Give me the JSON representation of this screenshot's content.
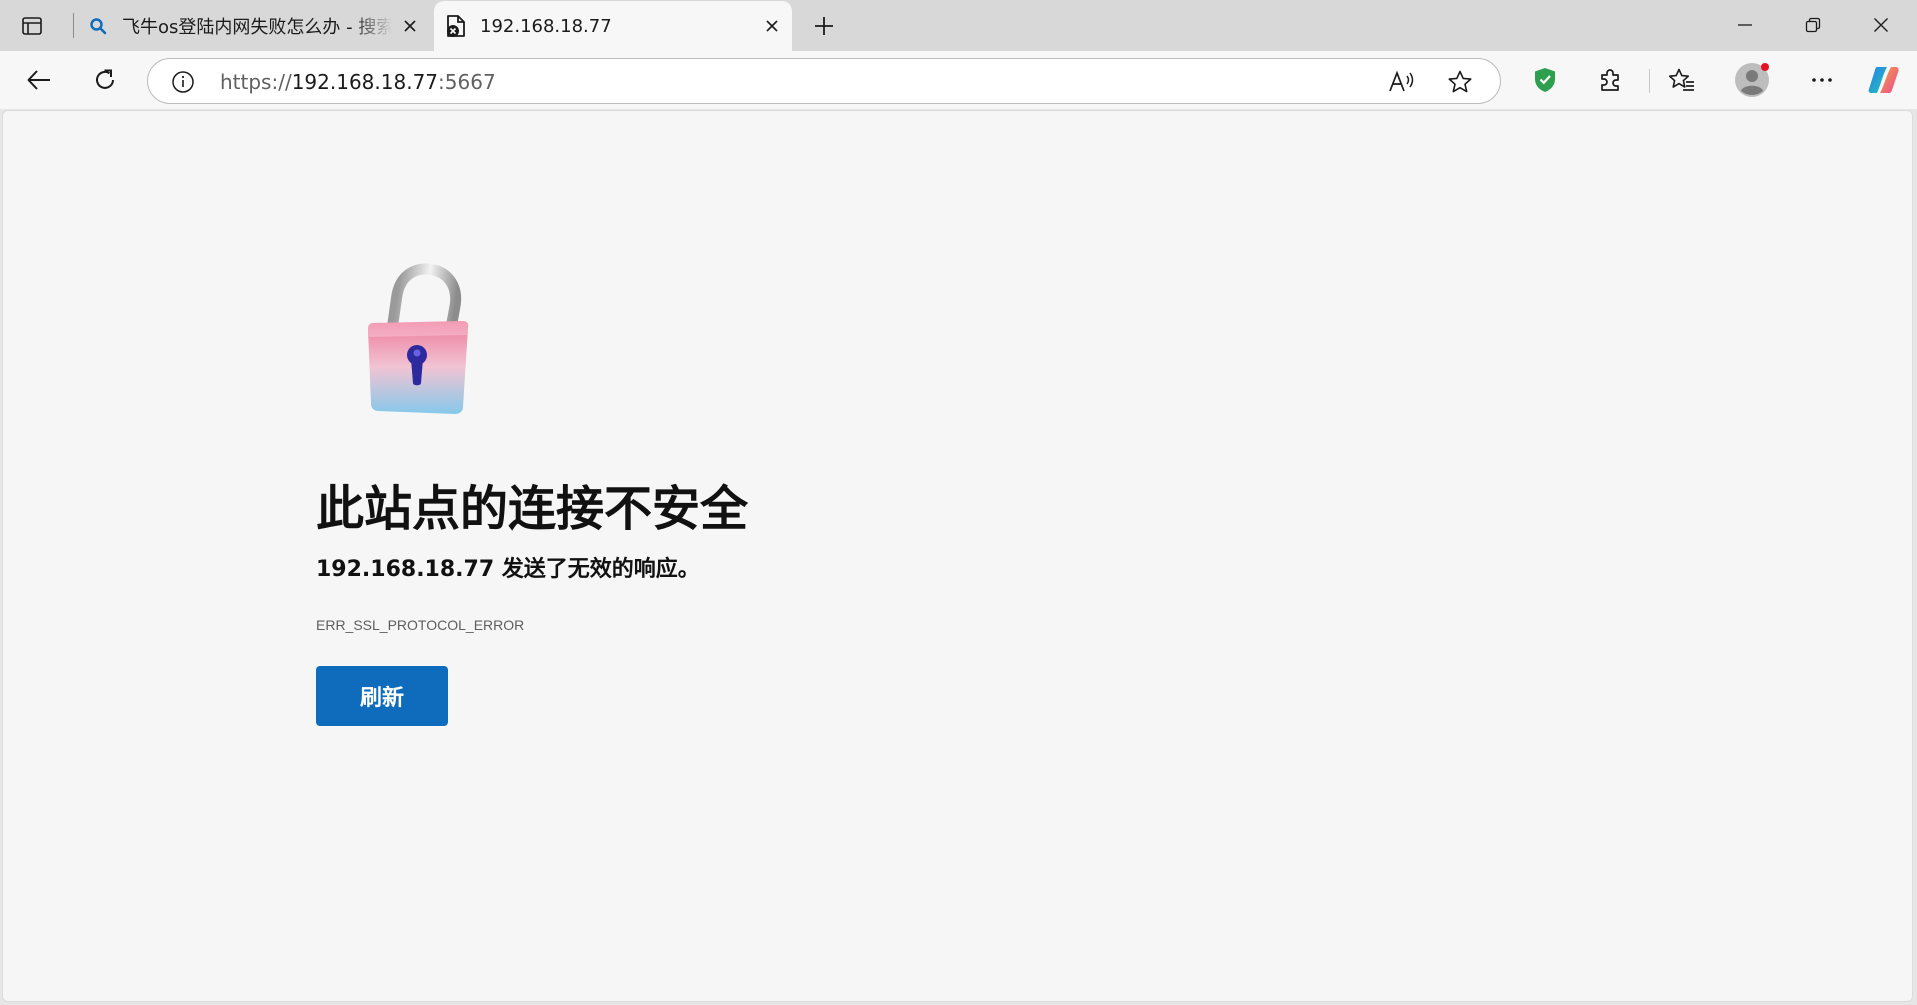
{
  "colors": {
    "accent": "#0f6cbd",
    "tab_strip": "#d8d8d8",
    "active_tab": "#f7f7f7",
    "page_bg": "#f6f6f6",
    "shield_green": "#2e9e4f",
    "notification_dot": "#e81123"
  },
  "tabs": [
    {
      "title": "飞牛os登陆内网失败怎么办 - 搜索",
      "icon": "search-icon",
      "active": false
    },
    {
      "title": "192.168.18.77",
      "icon": "page-error-icon",
      "active": true
    }
  ],
  "address_bar": {
    "scheme": "https://",
    "host": "192.168.18.77",
    "port": ":5667",
    "info_icon": "info-icon"
  },
  "toolbar_icons": [
    "back-icon",
    "refresh-icon",
    "read-aloud-icon",
    "favorite-star-icon",
    "shield-icon",
    "extensions-icon",
    "favorites-icon",
    "profile-icon",
    "more-icon",
    "copilot-icon"
  ],
  "error_page": {
    "title": "此站点的连接不安全",
    "subtitle": "192.168.18.77 发送了无效的响应。",
    "error_code": "ERR_SSL_PROTOCOL_ERROR",
    "reload_label": "刷新",
    "image": "unlocked-padlock-icon"
  }
}
